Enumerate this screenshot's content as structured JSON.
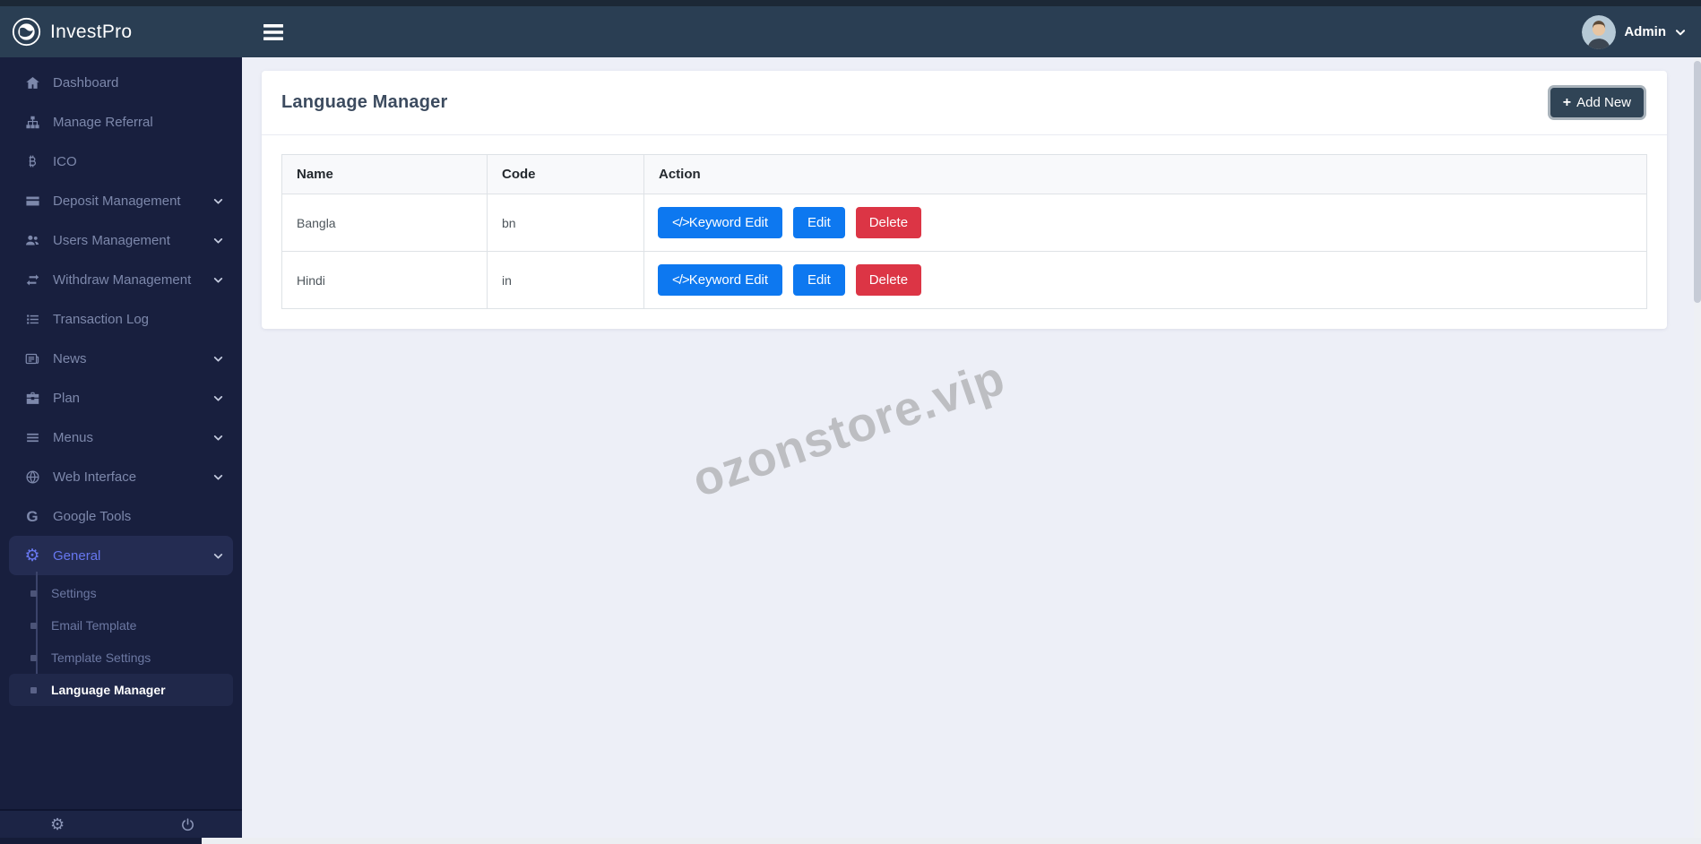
{
  "header": {
    "brand": "InvestPro",
    "user_name": "Admin"
  },
  "sidebar": {
    "items": [
      {
        "label": "Dashboard",
        "icon": "home-icon",
        "expandable": false
      },
      {
        "label": "Manage Referral",
        "icon": "sitemap-icon",
        "expandable": false
      },
      {
        "label": "ICO",
        "icon": "bitcoin-icon",
        "expandable": false
      },
      {
        "label": "Deposit Management",
        "icon": "credit-card-icon",
        "expandable": true
      },
      {
        "label": "Users Management",
        "icon": "users-icon",
        "expandable": true
      },
      {
        "label": "Withdraw Management",
        "icon": "exchange-icon",
        "expandable": true
      },
      {
        "label": "Transaction Log",
        "icon": "list-icon",
        "expandable": false
      },
      {
        "label": "News",
        "icon": "newspaper-icon",
        "expandable": true
      },
      {
        "label": "Plan",
        "icon": "briefcase-icon",
        "expandable": true
      },
      {
        "label": "Menus",
        "icon": "bars-icon",
        "expandable": true
      },
      {
        "label": "Web Interface",
        "icon": "globe-icon",
        "expandable": true
      },
      {
        "label": "Google Tools",
        "icon": "google-icon",
        "icon_glyph": "G",
        "expandable": false
      },
      {
        "label": "General",
        "icon": "gear-icon",
        "icon_glyph": "⚙",
        "expandable": true,
        "active": true
      }
    ],
    "general_submenu": [
      {
        "label": "Settings"
      },
      {
        "label": "Email Template"
      },
      {
        "label": "Template Settings"
      },
      {
        "label": "Language Manager",
        "active": true
      }
    ],
    "footer": {
      "settings_glyph": "⚙"
    }
  },
  "page": {
    "title": "Language Manager",
    "add_new_icon": "+",
    "add_new_label": "Add New"
  },
  "table": {
    "columns": [
      "Name",
      "Code",
      "Action"
    ],
    "rows": [
      {
        "name": "Bangla",
        "code": "bn"
      },
      {
        "name": "Hindi",
        "code": "in"
      }
    ],
    "actions": {
      "keyword_edit_icon": "</>",
      "keyword_edit_label": "Keyword Edit",
      "edit_label": "Edit",
      "delete_label": "Delete"
    }
  },
  "watermark": "ozonstore.vip",
  "colors": {
    "header_bg": "#2a3e53",
    "sidebar_bg": "#181f3e",
    "sidebar_active_text": "#6777ef",
    "primary_button": "#0d78f0",
    "danger_button": "#dc3545",
    "add_button": "#304456",
    "content_bg": "#edeff7"
  }
}
